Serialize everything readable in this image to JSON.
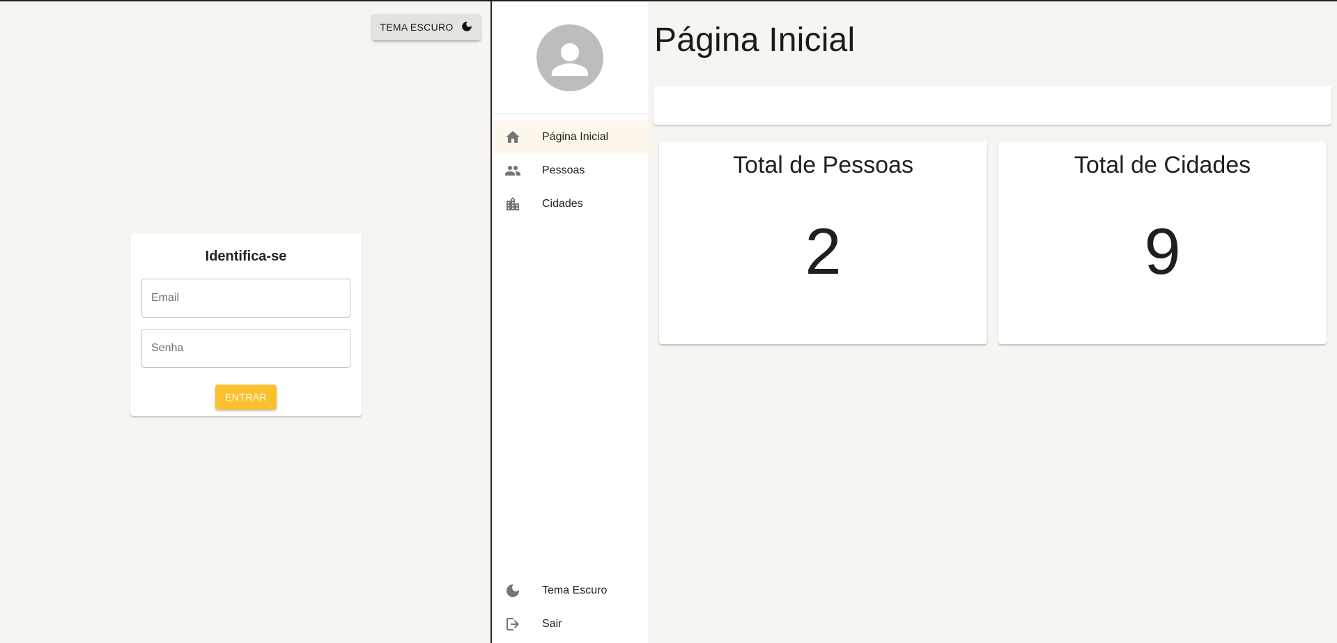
{
  "login": {
    "theme_toggle_label": "TEMA ESCURO",
    "title": "Identifica-se",
    "email_placeholder": "Email",
    "password_placeholder": "Senha",
    "submit_label": "ENTRAR"
  },
  "sidebar": {
    "items": [
      {
        "label": "Página Inicial",
        "icon": "home-icon",
        "active": true
      },
      {
        "label": "Pessoas",
        "icon": "people-icon"
      },
      {
        "label": "Cidades",
        "icon": "city-icon"
      }
    ],
    "bottom_items": [
      {
        "label": "Tema Escuro",
        "icon": "moon-icon"
      },
      {
        "label": "Sair",
        "icon": "logout-icon"
      }
    ]
  },
  "main": {
    "title": "Página Inicial",
    "cards": [
      {
        "title": "Total de Pessoas",
        "value": "2"
      },
      {
        "title": "Total de Cidades",
        "value": "9"
      }
    ]
  },
  "colors": {
    "accent": "#fbc02d",
    "background": "#f6f5f1",
    "active_nav_background": "#fdf8eb",
    "avatar": "#bdbdbd",
    "icon": "#757575"
  }
}
